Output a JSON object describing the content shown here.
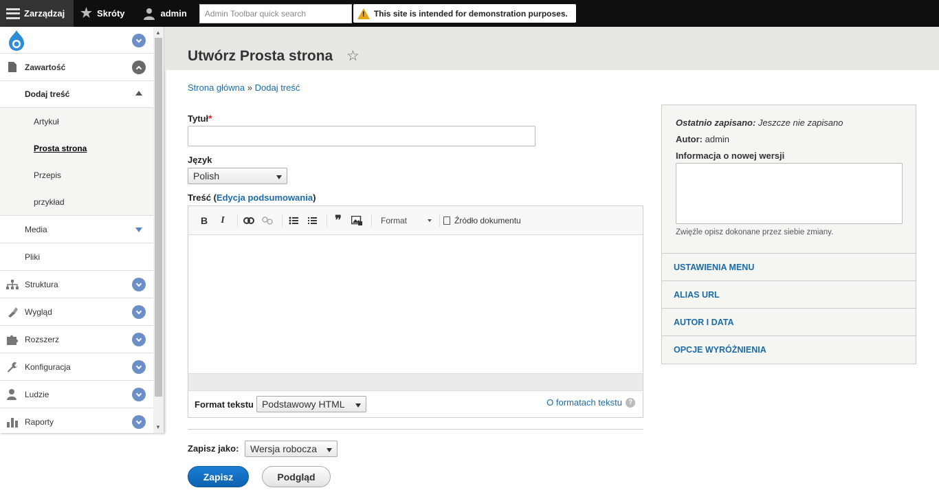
{
  "toolbar": {
    "manage": "Zarządzaj",
    "shortcuts": "Skróty",
    "user": "admin",
    "search_placeholder": "Admin Toolbar quick search",
    "warning": "This site is intended for demonstration purposes."
  },
  "sidebar": {
    "content": "Zawartość",
    "add_content": "Dodaj treść",
    "content_types": [
      "Artykuł",
      "Prosta strona",
      "Przepis",
      "przykład"
    ],
    "media": "Media",
    "files": "Pliki",
    "structure": "Struktura",
    "appearance": "Wygląd",
    "extend": "Rozszerz",
    "config": "Konfiguracja",
    "people": "Ludzie",
    "reports": "Raporty"
  },
  "page": {
    "title": "Utwórz Prosta strona",
    "breadcrumb_home": "Strona główna",
    "breadcrumb_sep": "»",
    "breadcrumb_add": "Dodaj treść"
  },
  "form": {
    "title_label": "Tytuł",
    "required_mark": "*",
    "language_label": "Język",
    "language_value": "Polish",
    "body_label": "Treść (",
    "body_label_link": "Edycja podsumowania",
    "body_label_end": ")",
    "editor_format": "Format",
    "editor_source": "Źródło dokumentu",
    "text_format_label": "Format tekstu",
    "text_format_value": "Podstawowy HTML",
    "about_formats": "O formatach tekstu",
    "help_glyph": "?",
    "save_as_label": "Zapisz jako:",
    "save_as_value": "Wersja robocza",
    "save_button": "Zapisz",
    "preview_button": "Podgląd"
  },
  "meta": {
    "last_saved_label": "Ostatnio zapisano:",
    "last_saved_value": "Jeszcze nie zapisano",
    "author_label": "Autor:",
    "author_value": "admin",
    "revision_label": "Informacja o nowej wersji",
    "revision_help": "Zwięźle opisz dokonane przez siebie zmiany.",
    "sections": [
      "USTAWIENIA MENU",
      "ALIAS URL",
      "AUTOR I DATA",
      "OPCJE WYRÓŻNIENIA"
    ]
  }
}
